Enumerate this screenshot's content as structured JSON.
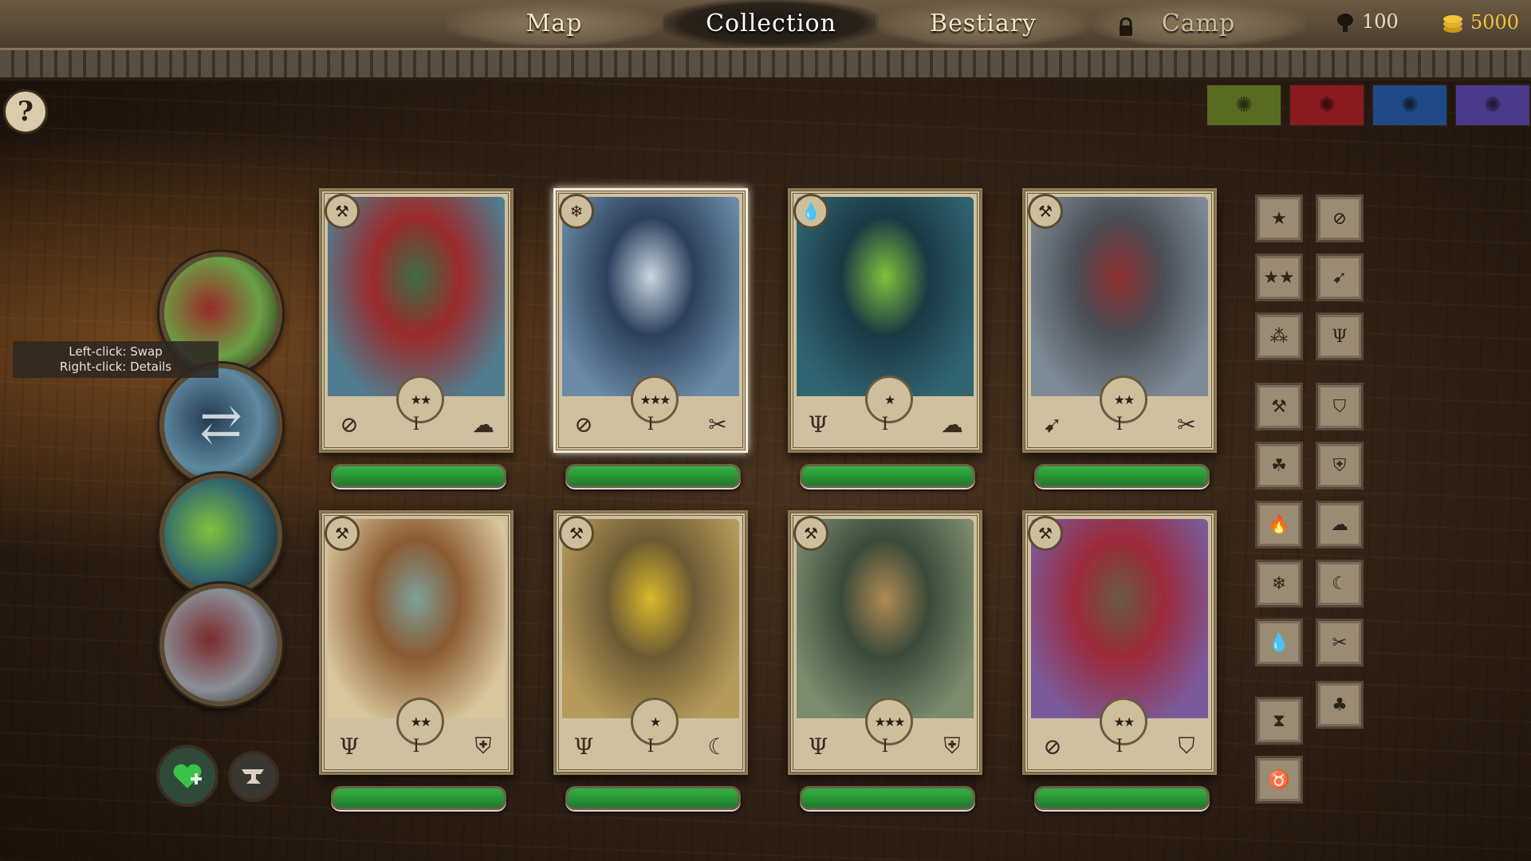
{
  "nav": {
    "tabs": [
      {
        "label": "Map",
        "state": "normal"
      },
      {
        "label": "Collection",
        "state": "active"
      },
      {
        "label": "Bestiary",
        "state": "normal"
      },
      {
        "label": "Camp",
        "state": "locked"
      }
    ]
  },
  "resources": {
    "food": "100",
    "gold": "5000"
  },
  "elements": [
    {
      "color": "#5a6b23",
      "icon": "green-element-icon"
    },
    {
      "color": "#8a1a22",
      "icon": "red-element-icon"
    },
    {
      "color": "#1f4a86",
      "icon": "blue-element-icon"
    },
    {
      "color": "#4b3a8a",
      "icon": "purple-element-icon"
    }
  ],
  "tooltip": {
    "line1": "Left-click: Swap",
    "line2": "Right-click: Details"
  },
  "cards": [
    {
      "class_icon": "hammer-axe-icon",
      "stars": 2,
      "star_glyph": "★★",
      "left_icon": "ranged-icon",
      "level": "I",
      "right_icon": "beast-icon",
      "health": 1.0,
      "art": [
        "#4f7d8f",
        "#9b2a2a",
        "#3d6e4a"
      ],
      "selected": false
    },
    {
      "class_icon": "snowflake-icon",
      "stars": 3,
      "star_glyph": "★★★",
      "left_icon": "ranged-icon",
      "level": "I",
      "right_icon": "crossed-keys-icon",
      "health": 1.0,
      "art": [
        "#6a8aa6",
        "#2d3f5c",
        "#c9d6e0"
      ],
      "selected": true
    },
    {
      "class_icon": "drop-icon",
      "stars": 1,
      "star_glyph": "★",
      "left_icon": "trident-icon",
      "level": "I",
      "right_icon": "beast-icon",
      "health": 1.0,
      "art": [
        "#2f6470",
        "#1a3a44",
        "#7ec23b"
      ],
      "selected": false
    },
    {
      "class_icon": "hammer-axe-icon",
      "stars": 2,
      "star_glyph": "★★",
      "left_icon": "bow-icon",
      "level": "I",
      "right_icon": "crossed-keys-icon",
      "health": 1.0,
      "art": [
        "#7d8a95",
        "#4a4e55",
        "#8c2f2f"
      ],
      "selected": false
    },
    {
      "class_icon": "hammer-axe-icon",
      "stars": 2,
      "star_glyph": "★★",
      "left_icon": "trident-icon",
      "level": "I",
      "right_icon": "helmet-icon",
      "health": 1.0,
      "art": [
        "#d8c79c",
        "#8a5a32",
        "#7da09a"
      ],
      "selected": false
    },
    {
      "class_icon": "hammer-axe-icon",
      "stars": 1,
      "star_glyph": "★",
      "left_icon": "trident-icon",
      "level": "I",
      "right_icon": "moon-icon",
      "health": 1.0,
      "art": [
        "#b59a5a",
        "#6b5a33",
        "#d9b82a"
      ],
      "selected": false
    },
    {
      "class_icon": "hammer-axe-icon",
      "stars": 3,
      "star_glyph": "★★★",
      "left_icon": "trident-icon",
      "level": "I",
      "right_icon": "helmet-icon",
      "health": 1.0,
      "art": [
        "#7c8a6e",
        "#3a4a3a",
        "#b08a52"
      ],
      "selected": false
    },
    {
      "class_icon": "hammer-axe-icon",
      "stars": 2,
      "star_glyph": "★★",
      "left_icon": "ranged-icon",
      "level": "I",
      "right_icon": "shield-icon",
      "health": 1.0,
      "art": [
        "#7a5a9a",
        "#9c2a3a",
        "#6a5a4a"
      ],
      "selected": false
    }
  ],
  "party": [
    {
      "art": [
        "#6aa045",
        "#9a2a2a"
      ],
      "icon": "lizard-portrait"
    },
    {
      "art": [
        "#5e8aa2",
        "#263a50"
      ],
      "icon": "swap-portrait"
    },
    {
      "art": [
        "#2f6470",
        "#7ec23b"
      ],
      "icon": "serpent-portrait"
    },
    {
      "art": [
        "#8a8f98",
        "#7a2a2a"
      ],
      "icon": "rat-portrait"
    }
  ],
  "filters": {
    "left": [
      {
        "glyph": "★",
        "icon": "one-star-icon"
      },
      {
        "glyph": "★★",
        "icon": "two-star-icon"
      },
      {
        "glyph": "⁂",
        "icon": "three-star-icon"
      },
      {
        "glyph": "⚒",
        "icon": "hammer-axe-icon"
      },
      {
        "glyph": "☘",
        "icon": "triquetra-icon"
      },
      {
        "glyph": "🔥",
        "icon": "fire-icon"
      },
      {
        "glyph": "❄",
        "icon": "snowflake-icon"
      },
      {
        "glyph": "💧",
        "icon": "drop-icon"
      },
      {
        "glyph": "⧗",
        "icon": "hourglass-icon"
      },
      {
        "glyph": "♉",
        "icon": "horns-icon"
      }
    ],
    "right": [
      {
        "glyph": "⊘",
        "icon": "ranged-icon"
      },
      {
        "glyph": "➹",
        "icon": "bow-icon"
      },
      {
        "glyph": "Ψ",
        "icon": "trident-icon"
      },
      {
        "glyph": "⛉",
        "icon": "shield-icon"
      },
      {
        "glyph": "⛨",
        "icon": "helmet-icon"
      },
      {
        "glyph": "☁",
        "icon": "beast-icon"
      },
      {
        "glyph": "☾",
        "icon": "moon-icon"
      },
      {
        "glyph": "✂",
        "icon": "crossed-keys-icon"
      },
      {
        "glyph": "♣",
        "icon": "plant-icon"
      }
    ]
  }
}
